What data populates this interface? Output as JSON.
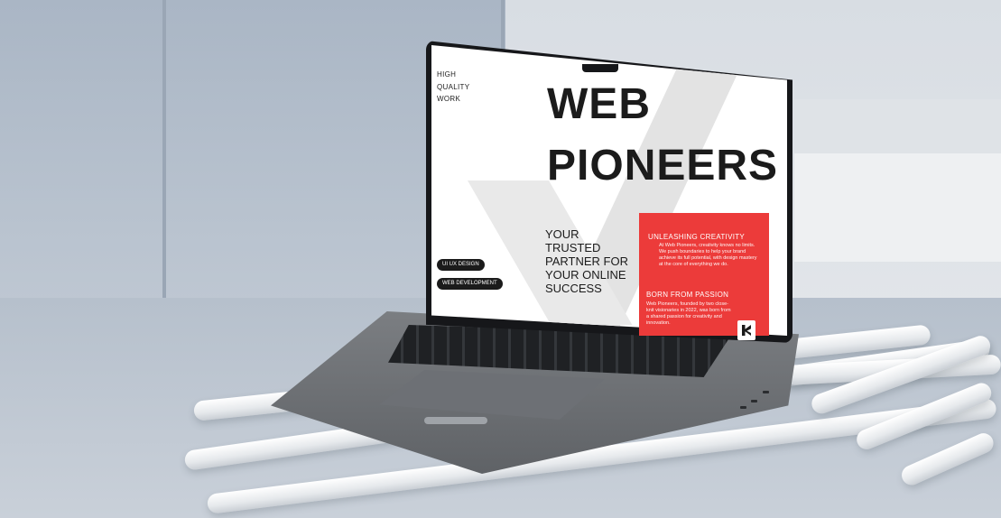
{
  "screen_page": {
    "side_label": [
      "HIGH",
      "QUALITY",
      "WORK"
    ],
    "headline_1": "WEB",
    "headline_2": "PIONEERS",
    "tagline": [
      "YOUR",
      "TRUSTED",
      "PARTNER FOR",
      "YOUR ONLINE",
      "SUCCESS"
    ],
    "pills": [
      "UI UX DESIGN",
      "WEB DEVELOPMENT"
    ],
    "panel": {
      "heading_1": "UNLEASHING CREATIVITY",
      "body_1": "At Web Pioneers, creativity knows no limits. We push boundaries to help your brand achieve its full potential, with design mastery at the core of everything we do.",
      "heading_2": "BORN FROM PASSION",
      "body_2": "Web Pioneers, founded by two close-knit visionaries in 2022, was born from a shared passion for creativity and innovation."
    },
    "logo_icon": "web-pioneers-logo-icon"
  },
  "colors": {
    "accent_red": "#ec3b3a",
    "text_dark": "#1b1b1b",
    "chevron_grey": "#e3e3e3",
    "laptop_body": "#6d7075",
    "wall": "#b9c3cf"
  }
}
